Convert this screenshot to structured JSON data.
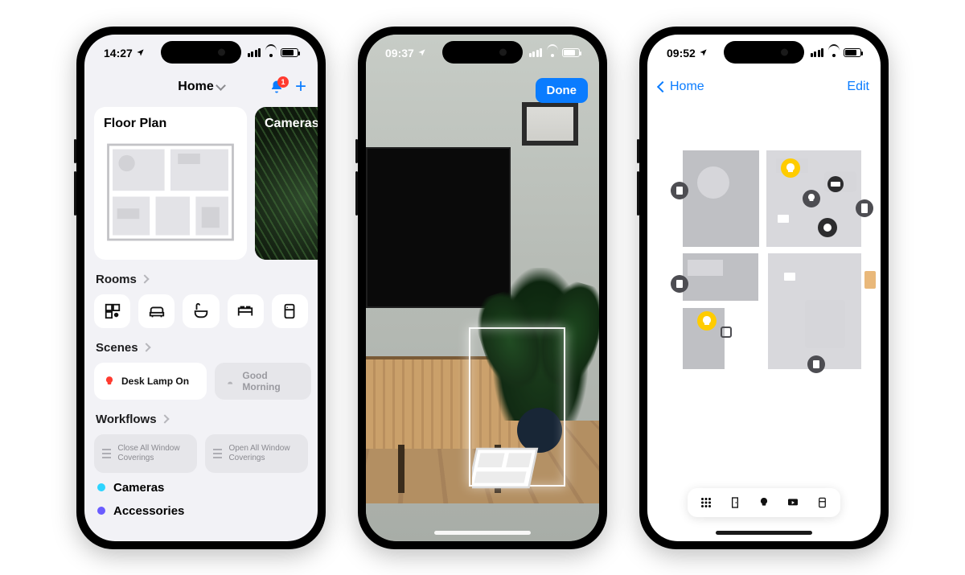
{
  "phone1": {
    "status": {
      "time": "14:27"
    },
    "nav": {
      "title": "Home",
      "notification_count": "1"
    },
    "cards": {
      "floor_plan": "Floor Plan",
      "cameras": "Cameras"
    },
    "sections": {
      "rooms": "Rooms",
      "scenes": "Scenes",
      "workflows": "Workflows"
    },
    "scenes": {
      "active": "Desk Lamp On",
      "inactive": "Good Morning"
    },
    "workflows": {
      "a": "Close All Window Coverings",
      "b": "Open All Window Coverings"
    },
    "list": {
      "cameras": "Cameras",
      "accessories": "Accessories"
    }
  },
  "phone2": {
    "status": {
      "time": "09:37"
    },
    "done": "Done"
  },
  "phone3": {
    "status": {
      "time": "09:52"
    },
    "back": "Home",
    "edit": "Edit"
  }
}
